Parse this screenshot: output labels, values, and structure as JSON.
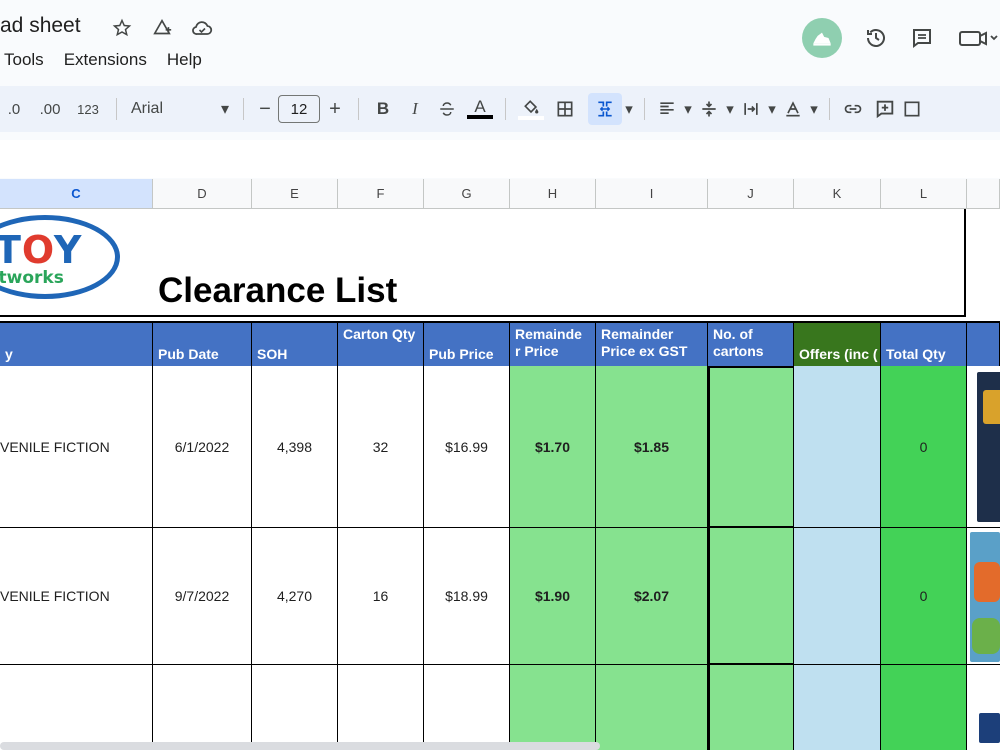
{
  "header": {
    "doc_title": "ad sheet",
    "menu": [
      "Tools",
      "Extensions",
      "Help"
    ]
  },
  "toolbar": {
    "decimal_decrease": ".0",
    "decimal_increase": ".00",
    "number_format": "123",
    "font": "Arial",
    "font_size": "12",
    "bold": "B",
    "italic": "I",
    "text_color": "A"
  },
  "columns": [
    "C",
    "D",
    "E",
    "F",
    "G",
    "H",
    "I",
    "J",
    "K",
    "L"
  ],
  "sheet": {
    "logo_top": "TOY",
    "logo_bottom": "etworks",
    "title": "Clearance List",
    "headers": {
      "category": "y",
      "pub_date": "Pub Date",
      "soh": "SOH",
      "carton_qty": "Carton Qty",
      "pub_price": "Pub Price",
      "remainder_price": "Remainde r Price",
      "remainder_ex_gst": "Remainder Price ex GST",
      "no_cartons": "No. of cartons",
      "offers": "Offers (inc (",
      "total_qty": "Total Qty"
    },
    "rows": [
      {
        "category": "VENILE FICTION",
        "pub_date": "6/1/2022",
        "soh": "4,398",
        "carton_qty": "32",
        "pub_price": "$16.99",
        "remainder_price": "$1.70",
        "remainder_ex_gst": "$1.85",
        "no_cartons": "",
        "offers": "",
        "total_qty": "0"
      },
      {
        "category": "VENILE FICTION",
        "pub_date": "9/7/2022",
        "soh": "4,270",
        "carton_qty": "16",
        "pub_price": "$18.99",
        "remainder_price": "$1.90",
        "remainder_ex_gst": "$2.07",
        "no_cartons": "",
        "offers": "",
        "total_qty": "0"
      }
    ]
  },
  "colors": {
    "header_blue": "#4472c4",
    "light_green": "#86e28f",
    "light_blue": "#bfe0f0",
    "bright_green": "#43d257",
    "offers_header_green": "#38761d"
  }
}
